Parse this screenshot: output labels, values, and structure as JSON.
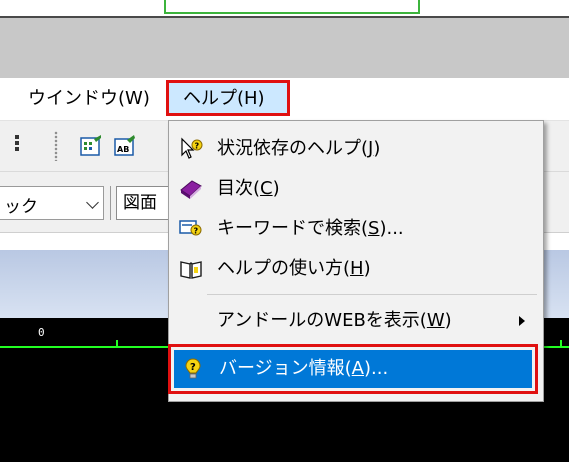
{
  "menubar": {
    "window": {
      "label": "ウインドウ(W)"
    },
    "help": {
      "label": "ヘルプ(H)"
    }
  },
  "toolbar2": {
    "combo_value": "ック",
    "zumen_label": "図面"
  },
  "ruler": {
    "zero": "0"
  },
  "help_menu": {
    "items": [
      {
        "text": "状況依存のヘルプ(",
        "key": "J",
        "end": ")",
        "icon": "context-help-icon"
      },
      {
        "text": "目次(",
        "key": "C",
        "end": ")",
        "icon": "book-icon"
      },
      {
        "text": "キーワードで検索(",
        "key": "S",
        "end": ")...",
        "icon": "keyword-search-icon"
      },
      {
        "text": "ヘルプの使い方(",
        "key": "H",
        "end": ")",
        "icon": "help-book-icon"
      }
    ],
    "web": {
      "text": "アンドールのWEBを表示(",
      "key": "W",
      "end": ")"
    },
    "version": {
      "text": "バージョン情報(",
      "key": "A",
      "end": ")...",
      "icon": "question-bulb-icon"
    }
  },
  "colors": {
    "highlight": "#0078d7",
    "callout": "#e01010",
    "ruler": "#22ff22"
  }
}
